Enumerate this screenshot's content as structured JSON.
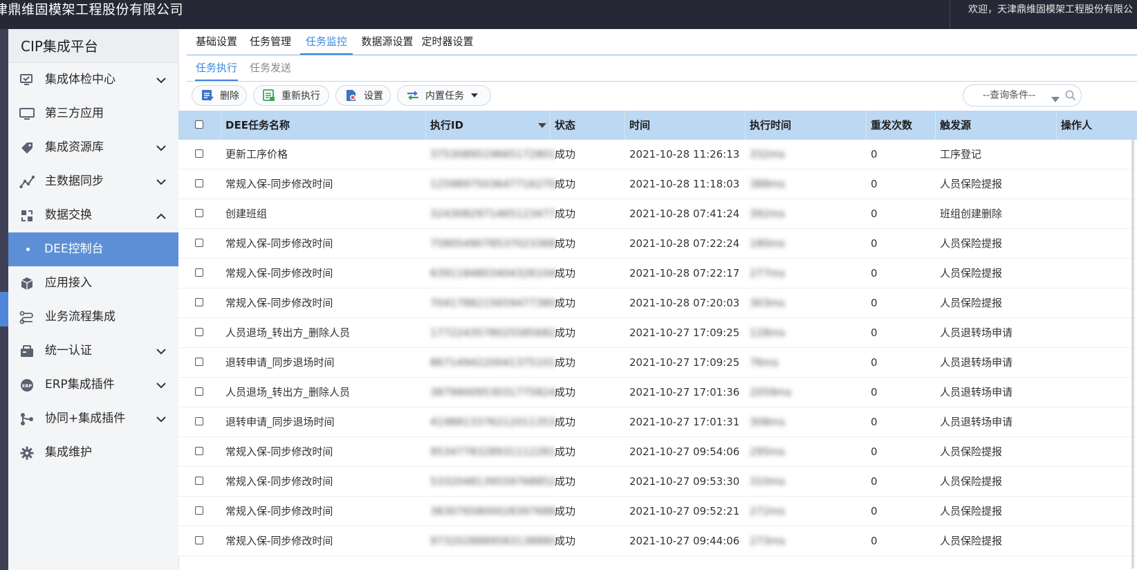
{
  "header": {
    "brand": "津鼎维固模架工程股份有限公司",
    "welcome": "欢迎，天津鼎维固模架工程股份有限公"
  },
  "sidebar": {
    "title": "CIP集成平台",
    "items": [
      {
        "label": "集成体检中心",
        "icon": "monitor-check-icon",
        "chevron": "down"
      },
      {
        "label": "第三方应用",
        "icon": "monitor-icon",
        "chevron": ""
      },
      {
        "label": "集成资源库",
        "icon": "tag-icon",
        "chevron": "down"
      },
      {
        "label": "主数据同步",
        "icon": "graph-line-icon",
        "chevron": "down"
      },
      {
        "label": "数据交换",
        "icon": "exchange-icon",
        "chevron": "up"
      },
      {
        "label": "DEE控制台",
        "icon": "",
        "chevron": "",
        "active": true
      },
      {
        "label": "应用接入",
        "icon": "cube-icon",
        "chevron": ""
      },
      {
        "label": "业务流程集成",
        "icon": "flow-icon",
        "chevron": ""
      },
      {
        "label": "统一认证",
        "icon": "auth-icon",
        "chevron": "down"
      },
      {
        "label": "ERP集成插件",
        "icon": "erp-icon",
        "chevron": "down"
      },
      {
        "label": "协同+集成插件",
        "icon": "share-icon",
        "chevron": "down"
      },
      {
        "label": "集成维护",
        "icon": "gear-icon",
        "chevron": ""
      }
    ]
  },
  "tabs": [
    "基础设置",
    "任务管理",
    "任务监控",
    "数据源设置",
    "定时器设置"
  ],
  "active_tab": "任务监控",
  "subtabs": [
    "任务执行",
    "任务发送"
  ],
  "active_subtab": "任务执行",
  "toolbar": {
    "delete": "删除",
    "rerun": "重新执行",
    "settings": "设置",
    "builtin": "内置任务",
    "search_placeholder": "--查询条件--"
  },
  "table": {
    "columns": [
      "DEE任务名称",
      "执行ID",
      "状态",
      "时间",
      "执行时间",
      "重发次数",
      "触发源",
      "操作人"
    ],
    "rows": [
      {
        "name": "更新工序价格",
        "id": "3753089519665172801",
        "status": "成功",
        "time": "2021-10-28 11:26:13",
        "duration": "332ms",
        "retries": "0",
        "source": "工序登记"
      },
      {
        "name": "常规入保-同步修改时间",
        "id": "1259897503647716270",
        "status": "成功",
        "time": "2021-10-28 11:18:03",
        "duration": "388ms",
        "retries": "0",
        "source": "人员保险提报"
      },
      {
        "name": "创建班组",
        "id": "3243082971465123477",
        "status": "成功",
        "time": "2021-10-28 07:41:24",
        "duration": "392ms",
        "retries": "0",
        "source": "班组创建删除"
      },
      {
        "name": "常规入保-同步修改时间",
        "id": "7580549078537023368",
        "status": "成功",
        "time": "2021-10-28 07:22:24",
        "duration": "180ms",
        "retries": "0",
        "source": "人员保险提报"
      },
      {
        "name": "常规入保-同步修改时间",
        "id": "6391184803404326104",
        "status": "成功",
        "time": "2021-10-28 07:22:17",
        "duration": "277ms",
        "retries": "0",
        "source": "人员保险提报"
      },
      {
        "name": "常规入保-同步修改时间",
        "id": "7041788215659477380",
        "status": "成功",
        "time": "2021-10-28 07:20:03",
        "duration": "303ms",
        "retries": "0",
        "source": "人员保险提报"
      },
      {
        "name": "人员退场_转出方_删除人员",
        "id": "1772243578025585682",
        "status": "成功",
        "time": "2021-10-27 17:09:25",
        "duration": "128ms",
        "retries": "0",
        "source": "人员退转场申请"
      },
      {
        "name": "退转申请_同步退场时间",
        "id": "8671494220041375101",
        "status": "成功",
        "time": "2021-10-27 17:09:25",
        "duration": "76ms",
        "retries": "0",
        "source": "人员退转场申请"
      },
      {
        "name": "人员退场_转出方_删除人员",
        "id": "3879900953031775824",
        "status": "成功",
        "time": "2021-10-27 17:01:36",
        "duration": "2059ms",
        "retries": "0",
        "source": "人员退转场申请"
      },
      {
        "name": "退转申请_同步退场时间",
        "id": "4198813376212011353",
        "status": "成功",
        "time": "2021-10-27 17:01:31",
        "duration": "308ms",
        "retries": "0",
        "source": "人员退转场申请"
      },
      {
        "name": "常规入保-同步修改时间",
        "id": "9534778328931112281",
        "status": "成功",
        "time": "2021-10-27 09:54:06",
        "duration": "295ms",
        "retries": "0",
        "source": "人员保险提报"
      },
      {
        "name": "常规入保-同步修改时间",
        "id": "5332048139559768852",
        "status": "成功",
        "time": "2021-10-27 09:53:30",
        "duration": "310ms",
        "retries": "0",
        "source": "人员保险提报"
      },
      {
        "name": "常规入保-同步修改时间",
        "id": "3830765800028397688",
        "status": "成功",
        "time": "2021-10-27 09:52:21",
        "duration": "272ms",
        "retries": "0",
        "source": "人员保险提报"
      },
      {
        "name": "常规入保-同步修改时间",
        "id": "9732028889583138880",
        "status": "成功",
        "time": "2021-10-27 09:44:06",
        "duration": "273ms",
        "retries": "0",
        "source": "人员保险提报"
      }
    ]
  },
  "colors": {
    "header_bg": "#262835",
    "accent": "#3e87de",
    "active_menu": "#5c8fd6",
    "table_header": "#bcd8f2"
  }
}
